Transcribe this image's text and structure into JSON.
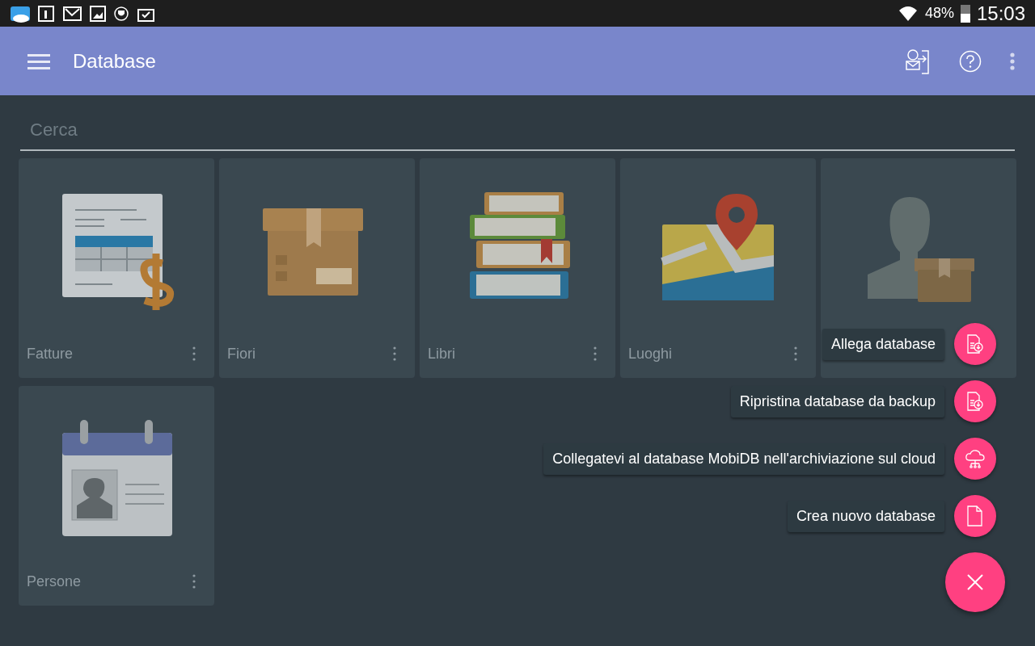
{
  "status_bar": {
    "battery": "48%",
    "time": "15:03"
  },
  "app_bar": {
    "title": "Database"
  },
  "search": {
    "placeholder": "Cerca"
  },
  "databases": [
    {
      "kind": "invoice",
      "name": "Fatture"
    },
    {
      "kind": "box",
      "name": "Fiori"
    },
    {
      "kind": "books",
      "name": "Libri"
    },
    {
      "kind": "map",
      "name": "Luoghi"
    },
    {
      "kind": "person-box"
    },
    {
      "kind": "id-card",
      "name": "Persone"
    }
  ],
  "speed_dial": {
    "open": true,
    "actions": [
      {
        "kind": "attach",
        "label": "Allega database"
      },
      {
        "kind": "restore",
        "label": "Ripristina database da backup"
      },
      {
        "kind": "cloud",
        "label": "Collegatevi al database MobiDB nell'archiviazione sul cloud"
      },
      {
        "kind": "new",
        "label": "Crea nuovo database"
      }
    ]
  }
}
